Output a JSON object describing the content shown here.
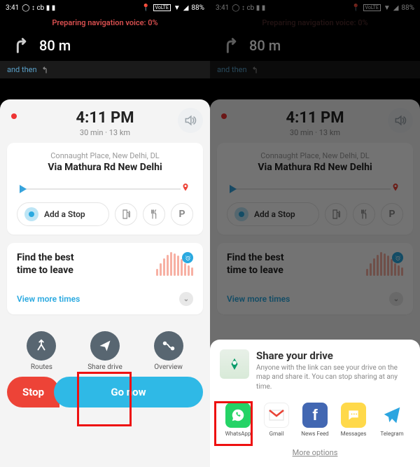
{
  "statusbar": {
    "time": "3:41",
    "battery": "88%",
    "volte": "VoLTE"
  },
  "banner": "Preparing navigation voice: 0%",
  "direction": {
    "distance": "80 m",
    "and_then": "and then"
  },
  "eta": {
    "time": "4:11 PM",
    "sub": "30 min · 13 km"
  },
  "destination": {
    "sub": "Connaught Place, New Delhi, DL",
    "main": "Via Mathura Rd New Delhi"
  },
  "add_stop": "Add a Stop",
  "best_time": {
    "line": "Find the best\ntime to leave",
    "link": "View more times"
  },
  "actions": {
    "routes": "Routes",
    "share": "Share drive",
    "overview": "Overview"
  },
  "buttons": {
    "stop": "Stop",
    "go": "Go now"
  },
  "share": {
    "title": "Share your drive",
    "desc": "Anyone with the link can see your drive on the map and share it. You can stop sharing at any time.",
    "apps": {
      "whatsapp": "WhatsApp",
      "gmail": "Gmail",
      "newsfeed": "News Feed",
      "messages": "Messages",
      "telegram": "Telegram"
    },
    "more": "More options"
  }
}
